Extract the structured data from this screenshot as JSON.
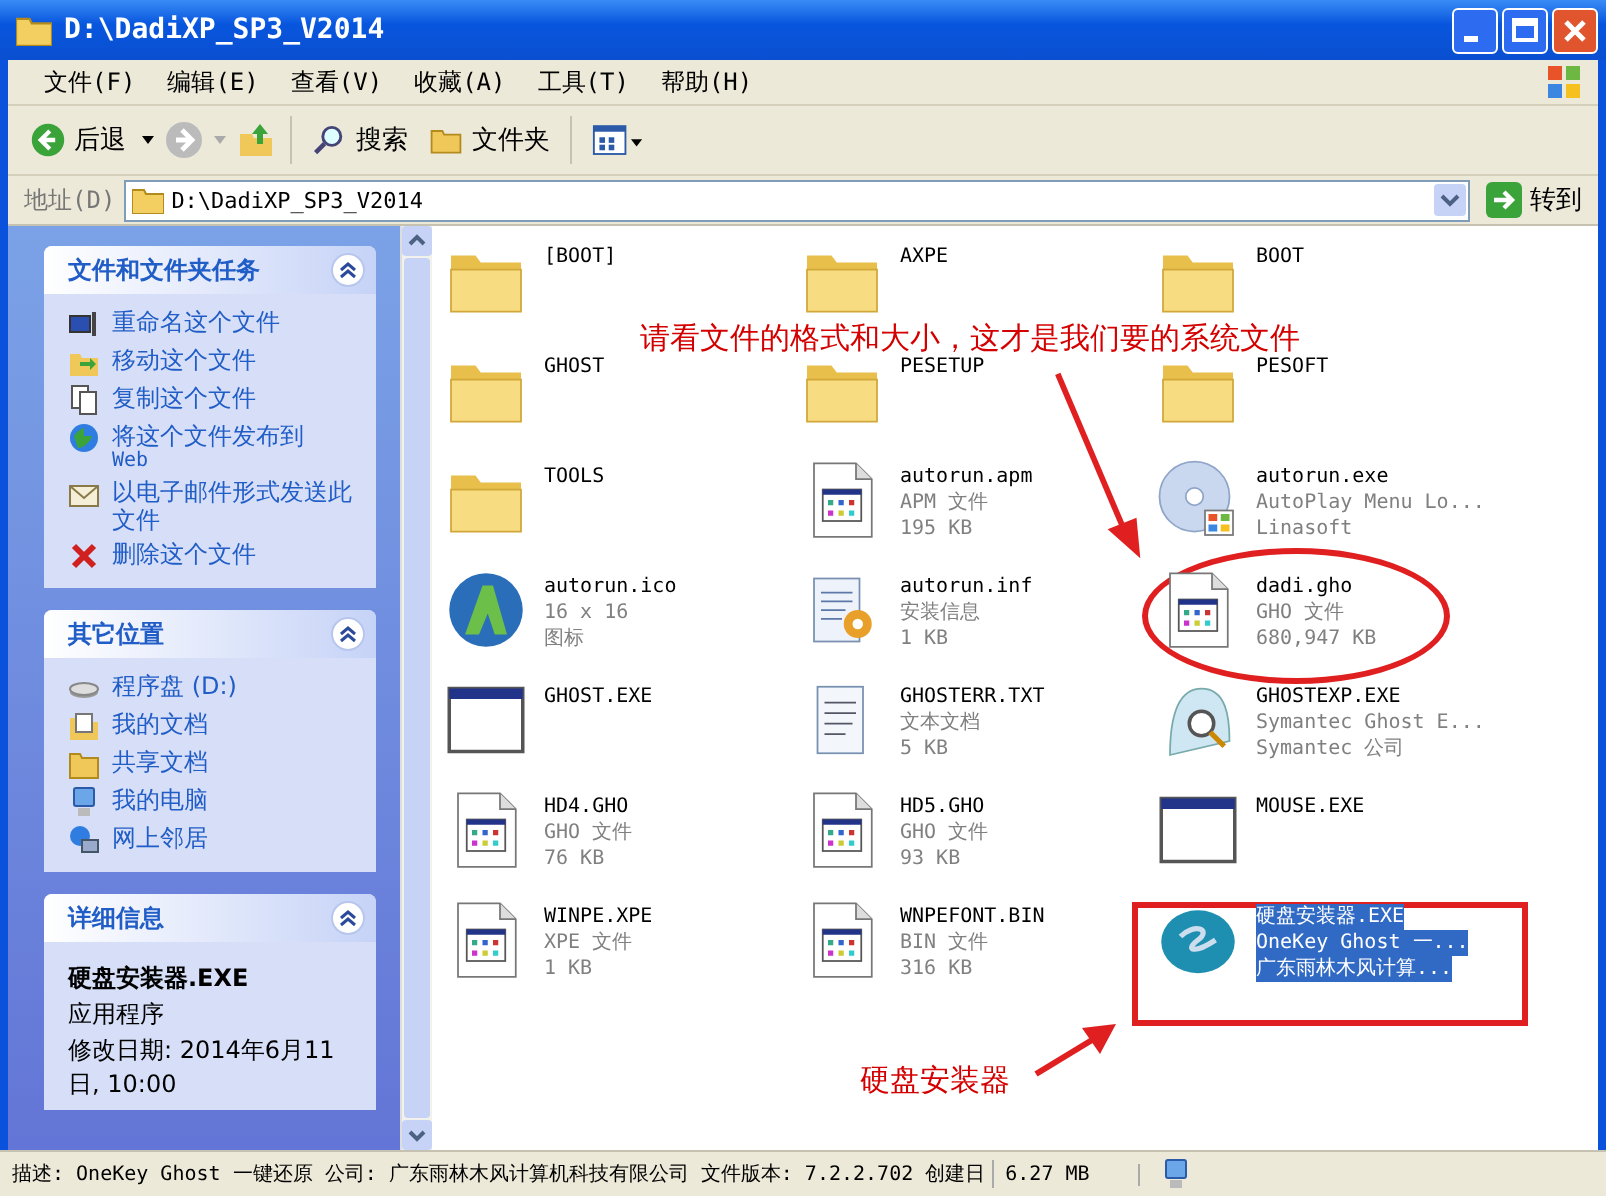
{
  "window": {
    "title": "D:\\DadiXP_SP3_V2014"
  },
  "menu": [
    "文件(F)",
    "编辑(E)",
    "查看(V)",
    "收藏(A)",
    "工具(T)",
    "帮助(H)"
  ],
  "toolbar": {
    "back": "后退",
    "search": "搜索",
    "folders": "文件夹"
  },
  "address": {
    "label": "地址(D)",
    "value": "D:\\DadiXP_SP3_V2014",
    "go": "转到"
  },
  "panels": [
    {
      "title": "文件和文件夹任务",
      "items": [
        {
          "kind": "rename",
          "label": "重命名这个文件"
        },
        {
          "kind": "move",
          "label": "移动这个文件"
        },
        {
          "kind": "copy",
          "label": "复制这个文件"
        },
        {
          "kind": "web",
          "label": "将这个文件发布到",
          "sub": "Web"
        },
        {
          "kind": "mail",
          "label": "以电子邮件形式发送此文件"
        },
        {
          "kind": "delete",
          "label": "删除这个文件"
        }
      ]
    },
    {
      "title": "其它位置",
      "items": [
        {
          "kind": "drive",
          "label": "程序盘 (D:)"
        },
        {
          "kind": "mydocs",
          "label": "我的文档"
        },
        {
          "kind": "shared",
          "label": "共享文档"
        },
        {
          "kind": "computer",
          "label": "我的电脑"
        },
        {
          "kind": "network",
          "label": "网上邻居"
        }
      ]
    }
  ],
  "details": {
    "title": "详细信息",
    "name": "硬盘安装器.EXE",
    "type": "应用程序",
    "modified": "修改日期: 2014年6月11日, 10:00"
  },
  "files": [
    {
      "kind": "folder",
      "name": "[BOOT]",
      "selected": false
    },
    {
      "kind": "folder",
      "name": "AXPE",
      "selected": false
    },
    {
      "kind": "folder",
      "name": "BOOT",
      "selected": false
    },
    {
      "kind": "folder",
      "name": "GHOST",
      "selected": false
    },
    {
      "kind": "folder",
      "name": "PESETUP",
      "selected": false
    },
    {
      "kind": "folder",
      "name": "PESOFT",
      "selected": false
    },
    {
      "kind": "folder",
      "name": "TOOLS",
      "selected": false
    },
    {
      "kind": "document",
      "name": "autorun.apm",
      "lines": [
        "APM 文件",
        "195 KB"
      ],
      "selected": false
    },
    {
      "kind": "disc",
      "name": "autorun.exe",
      "lines": [
        "AutoPlay Menu Lo...",
        "Linasoft"
      ],
      "selected": false
    },
    {
      "kind": "logo",
      "name": "autorun.ico",
      "lines": [
        "16 x 16",
        "图标"
      ],
      "selected": false
    },
    {
      "kind": "setup",
      "name": "autorun.inf",
      "lines": [
        "安装信息",
        "1 KB"
      ],
      "selected": false
    },
    {
      "kind": "document",
      "name": "dadi.gho",
      "lines": [
        "GHO 文件",
        "680,947 KB"
      ],
      "selected": false
    },
    {
      "kind": "program",
      "name": "GHOST.EXE",
      "selected": false
    },
    {
      "kind": "text",
      "name": "GHOSTERR.TXT",
      "lines": [
        "文本文档",
        "5 KB"
      ],
      "selected": false
    },
    {
      "kind": "ghost",
      "name": "GHOSTEXP.EXE",
      "lines": [
        "Symantec Ghost E...",
        "Symantec 公司"
      ],
      "selected": false
    },
    {
      "kind": "document",
      "name": "HD4.GHO",
      "lines": [
        "GHO 文件",
        "76 KB"
      ],
      "selected": false
    },
    {
      "kind": "document",
      "name": "HD5.GHO",
      "lines": [
        "GHO 文件",
        "93 KB"
      ],
      "selected": false
    },
    {
      "kind": "program",
      "name": "MOUSE.EXE",
      "selected": false
    },
    {
      "kind": "document",
      "name": "WINPE.XPE",
      "lines": [
        "XPE 文件",
        "1 KB"
      ],
      "selected": false
    },
    {
      "kind": "document",
      "name": "WNPEFONT.BIN",
      "lines": [
        "BIN 文件",
        "316 KB"
      ],
      "selected": false
    },
    {
      "kind": "onekey",
      "name": "硬盘安装器.EXE",
      "lines": [
        "OneKey Ghost 一...",
        "广东雨林木风计算..."
      ],
      "selected": true
    }
  ],
  "annotations": {
    "note": "请看文件的格式和大小，这才是我们要的系统文件",
    "label": "硬盘安装器"
  },
  "status_bar": {
    "description": "描述: OneKey Ghost 一键还原 公司: 广东雨林木风计算机科技有限公司 文件版本: 7.2.2.702 创建日",
    "size": "6.27 MB"
  }
}
